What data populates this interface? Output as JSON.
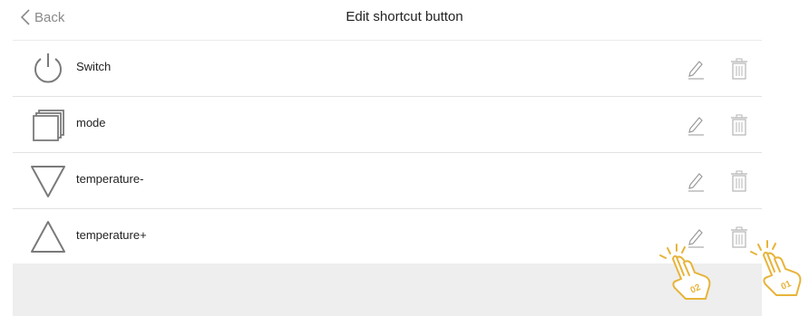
{
  "header": {
    "back_label": "Back",
    "title": "Edit shortcut button"
  },
  "rows": [
    {
      "label": "Switch",
      "icon": "power-icon"
    },
    {
      "label": "mode",
      "icon": "stack-icon"
    },
    {
      "label": "temperature-",
      "icon": "triangle-down-icon"
    },
    {
      "label": "temperature+",
      "icon": "triangle-up-icon"
    }
  ],
  "row_actions": {
    "edit_icon": "pencil-icon",
    "delete_icon": "trash-icon"
  },
  "annotations": {
    "tap_hints": [
      {
        "label": "02",
        "icon": "tap-hand-icon"
      },
      {
        "label": "01",
        "icon": "tap-hand-icon"
      }
    ]
  },
  "colors": {
    "icon_gray": "#7a7a7a",
    "action_gray": "#b5b5b5",
    "hint_gold": "#e7b43a",
    "divider": "#e2e2e2",
    "band": "#eeeeee"
  }
}
